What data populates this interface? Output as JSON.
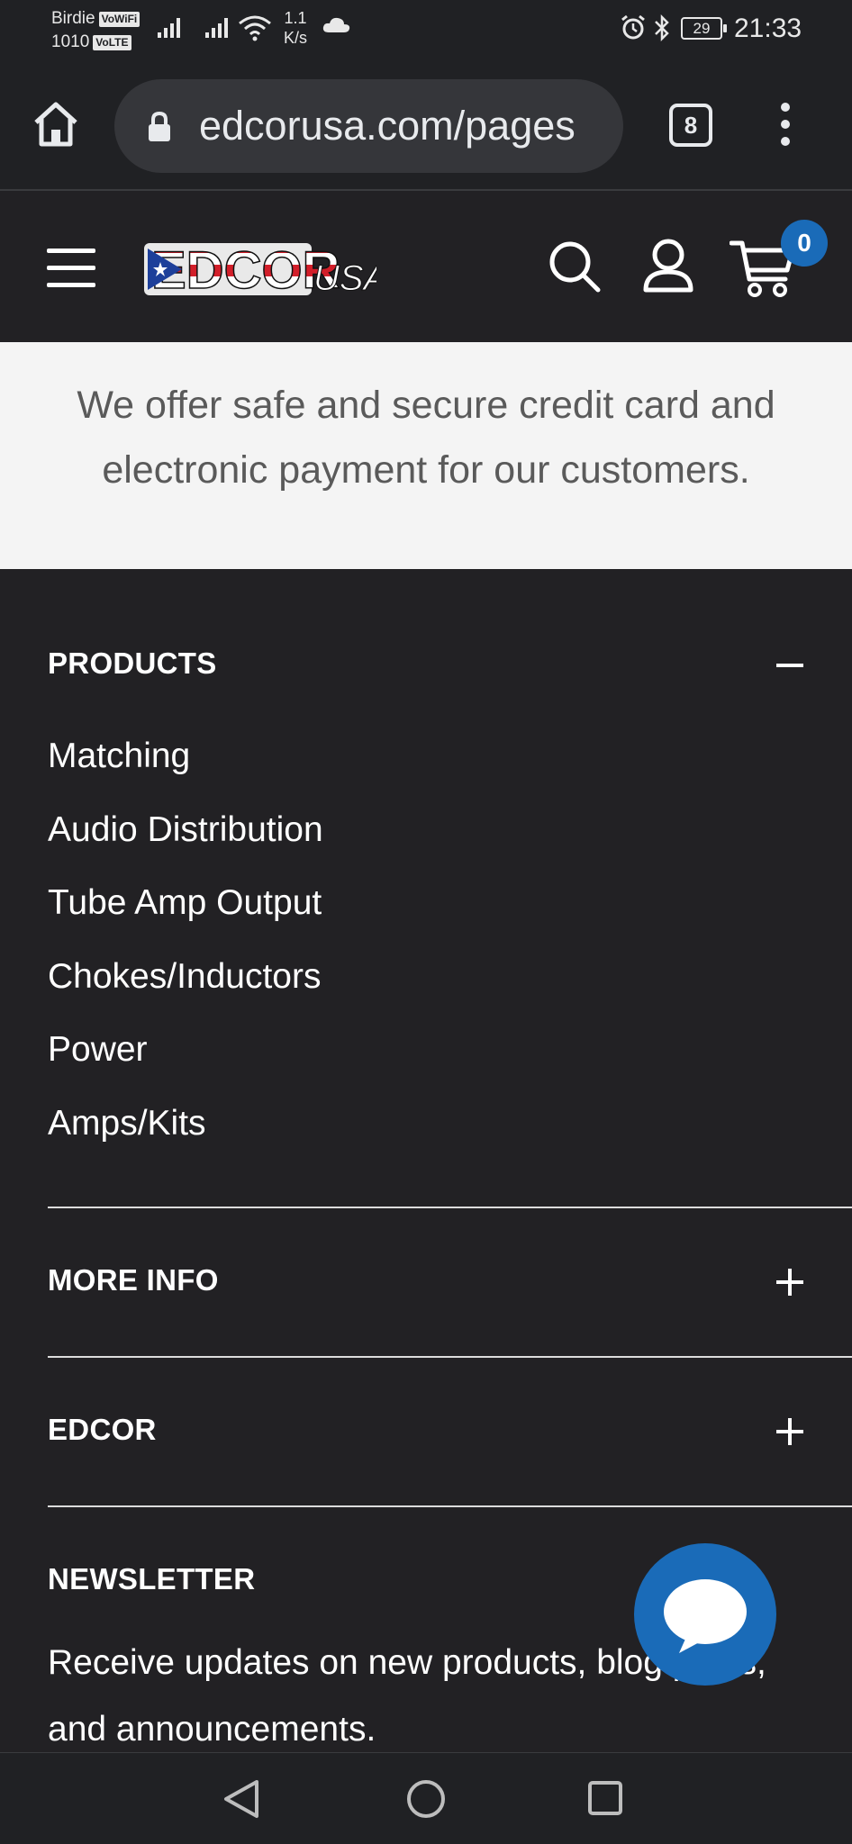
{
  "status_bar": {
    "carrier_line1": "Birdie",
    "carrier_tag1": "VoWiFi",
    "carrier_line2": "1010",
    "carrier_tag2": "VoLTE",
    "speed_value": "1.1",
    "speed_unit": "K/s",
    "battery": "29",
    "time": "21:33"
  },
  "browser": {
    "url": "edcorusa.com/pages",
    "tab_count": "8"
  },
  "header": {
    "logo_text_main": "EDCOR",
    "logo_text_suffix": "USA",
    "cart_count": "0"
  },
  "payment": {
    "description": "We offer safe and secure credit card and electronic payment for our customers."
  },
  "footer": {
    "products": {
      "title": "PRODUCTS",
      "links": [
        "Matching",
        "Audio Distribution",
        "Tube Amp Output",
        "Chokes/Inductors",
        "Power",
        "Amps/Kits"
      ]
    },
    "more_info": {
      "title": "MORE INFO"
    },
    "edcor": {
      "title": "EDCOR"
    },
    "newsletter": {
      "title": "NEWSLETTER",
      "text": "Receive updates on new products, blog posts, and announcements."
    }
  },
  "colors": {
    "accent": "#1a6bb8",
    "footer_bg": "#222124",
    "payment_bg": "#f4f4f4"
  }
}
